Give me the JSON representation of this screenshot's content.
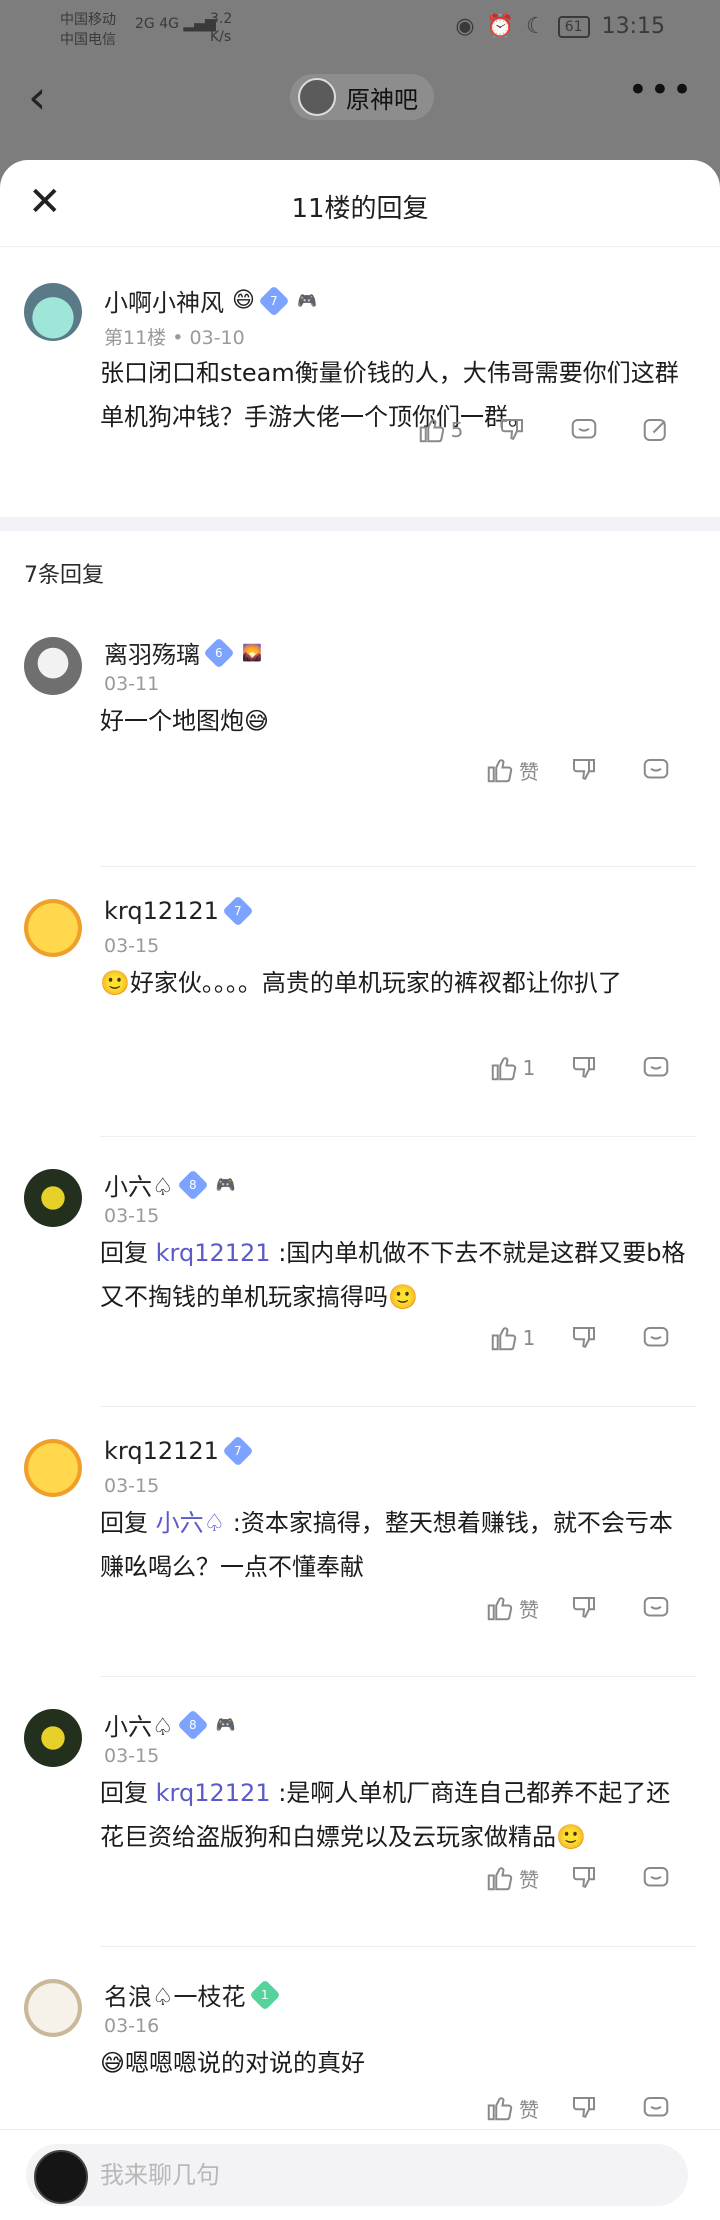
{
  "status": {
    "carrier1": "中国移动",
    "carrier2": "中国电信",
    "signal": "2G 4G",
    "net_speed": "3.2",
    "net_unit": "K/s",
    "battery": "61",
    "time": "13:15"
  },
  "nav": {
    "forum_name": "原神吧"
  },
  "sheet": {
    "title": "11楼的回复"
  },
  "post": {
    "username": "小啊小神风",
    "level": "7",
    "meta_floor": "第11楼",
    "meta_date": "03-10",
    "content": "张口闭口和steam衡量价钱的人，大伟哥需要你们这群单机狗冲钱？手游大佬一个顶你们一群。",
    "likes": "5"
  },
  "replies_header": "7条回复",
  "replies": [
    {
      "username": "离羽殇璃",
      "level": "6",
      "date": "03-11",
      "content": "好一个地图炮😅",
      "likes": "赞",
      "mention": "",
      "prefix": ""
    },
    {
      "username": "krq12121",
      "level": "7",
      "date": "03-15",
      "content": "🙂好家伙。。。。高贵的单机玩家的裤衩都让你扒了",
      "likes": "1",
      "mention": "",
      "prefix": ""
    },
    {
      "username": "小六♤",
      "level": "8",
      "date": "03-15",
      "prefix": "回复",
      "mention": "krq12121",
      "content": " :国内单机做不下去不就是这群又要b格又不掏钱的单机玩家搞得吗🙂",
      "likes": "1"
    },
    {
      "username": "krq12121",
      "level": "7",
      "date": "03-15",
      "prefix": "回复",
      "mention": "小六♤",
      "content": " :资本家搞得，整天想着赚钱，就不会亏本赚吆喝么？一点不懂奉献",
      "likes": "赞"
    },
    {
      "username": "小六♤",
      "level": "8",
      "date": "03-15",
      "prefix": "回复",
      "mention": "krq12121",
      "content": " :是啊人单机厂商连自己都养不起了还花巨资给盗版狗和白嫖党以及云玩家做精品🙂",
      "likes": "赞"
    },
    {
      "username": "名浪♤一枝花",
      "level": "1",
      "date": "03-16",
      "content": "😅嗯嗯嗯说的对说的真好",
      "likes": "赞",
      "mention": "",
      "prefix": ""
    }
  ],
  "input": {
    "placeholder": "我来聊几句"
  },
  "colors": {
    "mention": "#5b5bc8",
    "level_blue": "#7ba3ff",
    "level_green": "#55d39a"
  },
  "icons": [
    "back-icon",
    "more-icon",
    "close-icon",
    "thumb-up-icon",
    "thumb-down-icon",
    "comment-icon",
    "edit-icon"
  ]
}
